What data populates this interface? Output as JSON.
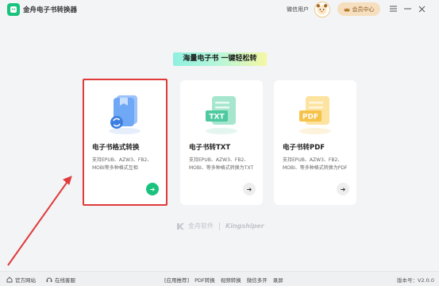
{
  "app": {
    "title": "金舟电子书转换器",
    "user_label": "微信用户",
    "member_label": "会员中心"
  },
  "window_controls": {
    "menu_icon": "menu-icon",
    "minimize_icon": "minimize-icon",
    "close_icon": "close-icon"
  },
  "banner": {
    "text": "海量电子书  一键轻松转"
  },
  "cards": [
    {
      "title": "电子书格式转换",
      "desc": "支持EPUB、AZW3、FB2、MOBI等多种格式互相",
      "icon": "book-convert-icon",
      "color": "#6fa9f5",
      "highlighted": true
    },
    {
      "title": "电子书转TXT",
      "desc": "支持EPUB、AZW3、FB2、MOBI、等多种格式转换为TXT",
      "icon": "txt-file-icon",
      "label": "TXT",
      "color": "#4fc9a0"
    },
    {
      "title": "电子书转PDF",
      "desc": "支持EPUB、AZW3、FB2、MOBI、等多种格式转换为PDF",
      "icon": "pdf-file-icon",
      "label": "PDF",
      "color": "#f5c24a"
    }
  ],
  "watermark": {
    "brand_cn": "金舟软件",
    "brand_en": "Kingshiper"
  },
  "footer": {
    "website": "官方网站",
    "support": "在线客服",
    "links": [
      "[应用推荐]",
      "PDF转换",
      "视频转换",
      "微信多开",
      "录屏"
    ],
    "version": "版本号：V2.0.0"
  },
  "colors": {
    "accent": "#19c37d",
    "highlight_border": "#e03a3a",
    "member_bg": "#f6dfbf"
  }
}
